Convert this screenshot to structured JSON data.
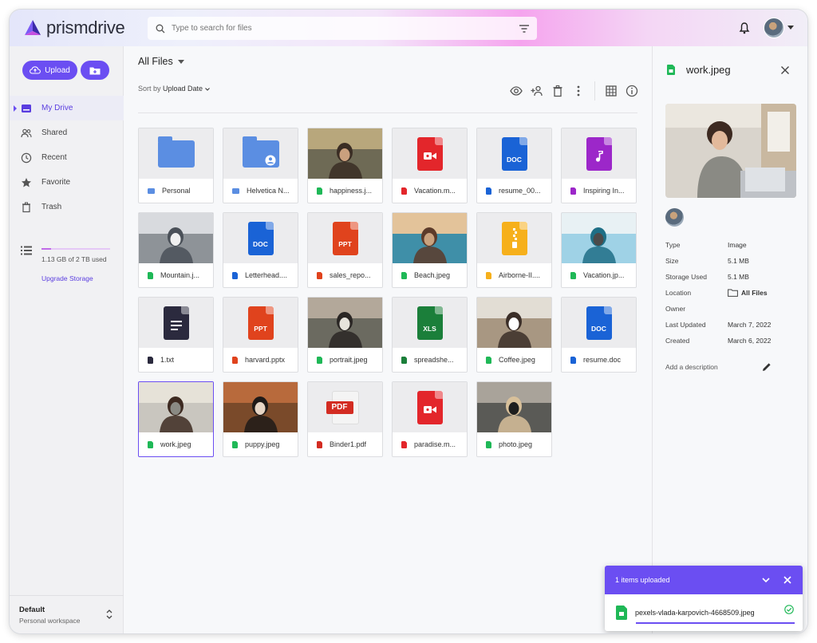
{
  "app": {
    "name": "prismdrive"
  },
  "header": {
    "search_placeholder": "Type to search for files"
  },
  "sidebar": {
    "upload_label": "Upload",
    "nav": [
      {
        "label": "My Drive",
        "icon": "drive-icon",
        "active": true
      },
      {
        "label": "Shared",
        "icon": "people-icon",
        "active": false
      },
      {
        "label": "Recent",
        "icon": "clock-icon",
        "active": false
      },
      {
        "label": "Favorite",
        "icon": "star-icon",
        "active": false
      },
      {
        "label": "Trash",
        "icon": "trash-icon",
        "active": false
      }
    ],
    "storage_text": "1.13 GB of 2 TB used",
    "storage_fraction": 0.0006,
    "upgrade_label": "Upgrade Storage",
    "workspace_title": "Default",
    "workspace_sub": "Personal workspace"
  },
  "main": {
    "title": "All Files",
    "sort_prefix": "Sort by",
    "sort_value": "Upload Date",
    "files": [
      {
        "name": "Personal",
        "kind": "folder",
        "thumb": "folder"
      },
      {
        "name": "Helvetica N...",
        "kind": "folder",
        "thumb": "folder-shared"
      },
      {
        "name": "happiness.j...",
        "kind": "image",
        "thumb": "photo"
      },
      {
        "name": "Vacation.m...",
        "kind": "video",
        "thumb": "video"
      },
      {
        "name": "resume_00...",
        "kind": "doc",
        "thumb": "doc",
        "tag": "DOC"
      },
      {
        "name": "Inspiring In...",
        "kind": "audio",
        "thumb": "audio"
      },
      {
        "name": "Mountain.j...",
        "kind": "image",
        "thumb": "photo"
      },
      {
        "name": "Letterhead....",
        "kind": "doc",
        "thumb": "doc",
        "tag": "DOC"
      },
      {
        "name": "sales_repo...",
        "kind": "ppt",
        "thumb": "ppt",
        "tag": "PPT"
      },
      {
        "name": "Beach.jpeg",
        "kind": "image",
        "thumb": "photo"
      },
      {
        "name": "Airborne-II....",
        "kind": "archive",
        "thumb": "archive"
      },
      {
        "name": "Vacation.jp...",
        "kind": "image",
        "thumb": "photo"
      },
      {
        "name": "1.txt",
        "kind": "text",
        "thumb": "text"
      },
      {
        "name": "harvard.pptx",
        "kind": "ppt",
        "thumb": "ppt",
        "tag": "PPT"
      },
      {
        "name": "portrait.jpeg",
        "kind": "image",
        "thumb": "photo"
      },
      {
        "name": "spreadshe...",
        "kind": "xls",
        "thumb": "xls",
        "tag": "XLS"
      },
      {
        "name": "Coffee.jpeg",
        "kind": "image",
        "thumb": "photo"
      },
      {
        "name": "resume.doc",
        "kind": "doc",
        "thumb": "doc",
        "tag": "DOC"
      },
      {
        "name": "work.jpeg",
        "kind": "image",
        "thumb": "photo",
        "selected": true
      },
      {
        "name": "puppy.jpeg",
        "kind": "image",
        "thumb": "photo"
      },
      {
        "name": "Binder1.pdf",
        "kind": "pdf",
        "thumb": "pdf",
        "tag": "PDF"
      },
      {
        "name": "paradise.m...",
        "kind": "video",
        "thumb": "video"
      },
      {
        "name": "photo.jpeg",
        "kind": "image",
        "thumb": "photo"
      }
    ]
  },
  "colors": {
    "accent": "#6b4ef2",
    "folder": "#5b8ee2",
    "image": "#1fb857",
    "video": "#e3262b",
    "doc": "#1a63d6",
    "audio": "#9c27c9",
    "ppt": "#e0431d",
    "archive": "#f6b01c",
    "text": "#2b2a3e",
    "xls": "#1b7f3a",
    "pdf": "#d32c22"
  },
  "details": {
    "file_name": "work.jpeg",
    "props": [
      {
        "key": "Type",
        "value": "Image"
      },
      {
        "key": "Size",
        "value": "5.1 MB"
      },
      {
        "key": "Storage Used",
        "value": "5.1 MB"
      },
      {
        "key": "Location",
        "value": "All Files",
        "folder": true
      },
      {
        "key": "Owner",
        "value": ""
      },
      {
        "key": "Last Updated",
        "value": "March 7, 2022"
      },
      {
        "key": "Created",
        "value": "March 6, 2022"
      }
    ],
    "add_description": "Add a description"
  },
  "toast": {
    "title": "1 items uploaded",
    "file": "pexels-vlada-karpovich-4668509.jpeg",
    "progress": 1.0
  }
}
